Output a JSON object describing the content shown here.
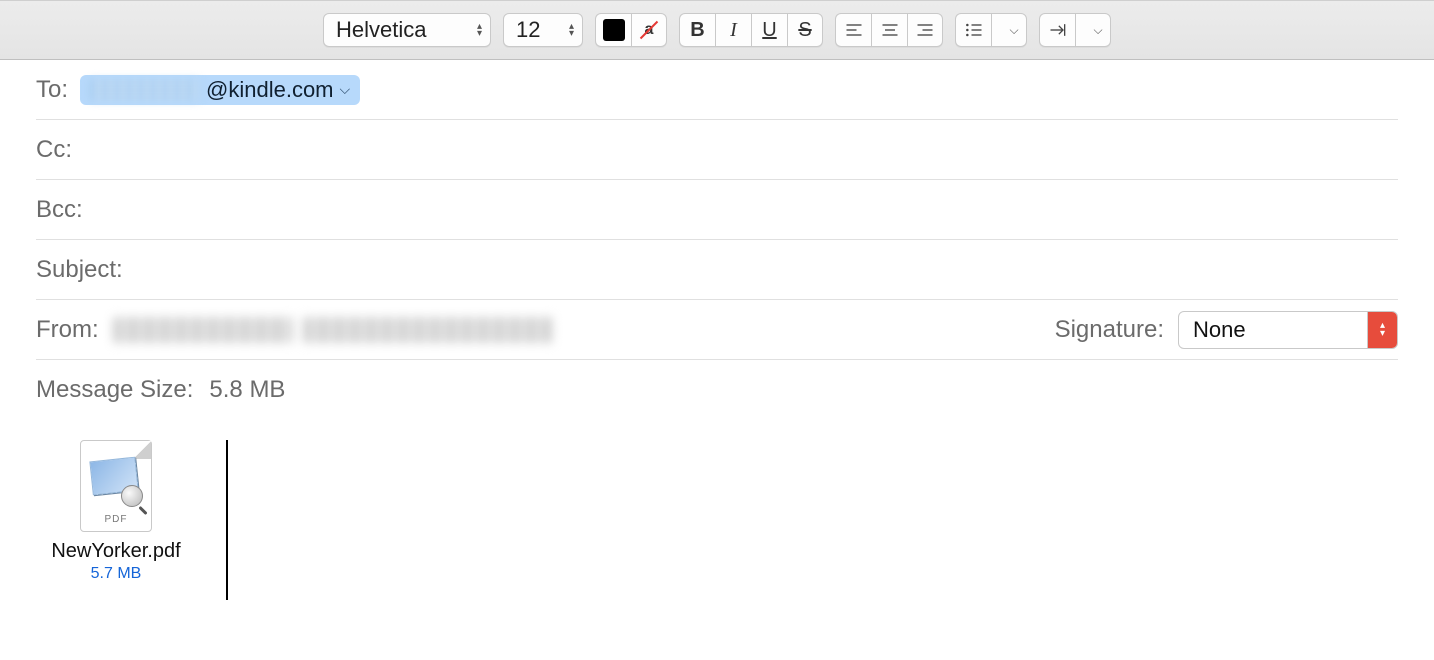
{
  "toolbar": {
    "font_family": "Helvetica",
    "font_size": "12",
    "bold": "B",
    "italic": "I",
    "underline": "U",
    "strike": "S",
    "color_icon": "text-color",
    "highlight_icon": "no-highlight"
  },
  "fields": {
    "to_label": "To:",
    "to_domain": "@kindle.com",
    "cc_label": "Cc:",
    "bcc_label": "Bcc:",
    "subject_label": "Subject:",
    "from_label": "From:",
    "signature_label": "Signature:",
    "signature_value": "None",
    "message_size_label": "Message Size:",
    "message_size_value": "5.8 MB"
  },
  "attachment": {
    "type_label": "PDF",
    "filename": "NewYorker.pdf",
    "filesize": "5.7 MB"
  }
}
